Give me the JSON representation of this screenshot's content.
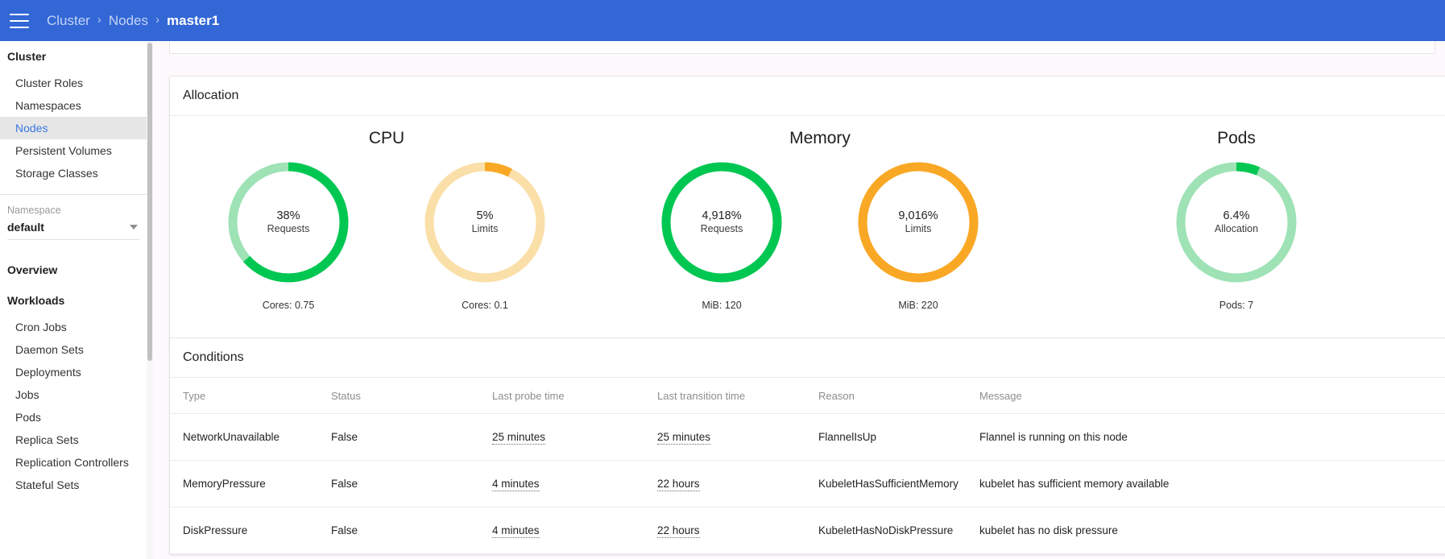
{
  "topbar": {
    "menu_icon": "hamburger-menu-icon",
    "breadcrumbs": [
      {
        "label": "Cluster",
        "current": false
      },
      {
        "label": "Nodes",
        "current": false
      },
      {
        "label": "master1",
        "current": true
      }
    ],
    "separator": "›",
    "background_color": "#3367d6"
  },
  "sidebar": {
    "cluster_title": "Cluster",
    "cluster_items": [
      {
        "label": "Cluster Roles",
        "active": false
      },
      {
        "label": "Namespaces",
        "active": false
      },
      {
        "label": "Nodes",
        "active": true
      },
      {
        "label": "Persistent Volumes",
        "active": false
      },
      {
        "label": "Storage Classes",
        "active": false
      }
    ],
    "namespace_label": "Namespace",
    "namespace_value": "default",
    "namespace_caret_icon": "chevron-down-icon",
    "overview_title": "Overview",
    "workloads_title": "Workloads",
    "workload_items": [
      {
        "label": "Cron Jobs"
      },
      {
        "label": "Daemon Sets"
      },
      {
        "label": "Deployments"
      },
      {
        "label": "Jobs"
      },
      {
        "label": "Pods"
      },
      {
        "label": "Replica Sets"
      },
      {
        "label": "Replication Controllers"
      },
      {
        "label": "Stateful Sets"
      }
    ],
    "active_color": "#3b78e7",
    "active_bg": "#e6e6e6"
  },
  "clipped_card": {
    "text": "…"
  },
  "allocation": {
    "title": "Allocation",
    "groups": [
      {
        "heading": "CPU",
        "donuts": [
          {
            "percent_label": "38%",
            "sub_label": "Requests",
            "footer_label": "Cores: 0.75",
            "fraction": 0.635,
            "arc_color": "#00c752",
            "track_color": "#9ee2b5"
          },
          {
            "percent_label": "5%",
            "sub_label": "Limits",
            "footer_label": "Cores: 0.1",
            "fraction": 0.075,
            "arc_color": "#f9a825",
            "track_color": "#fadfa8"
          }
        ]
      },
      {
        "heading": "Memory",
        "donuts": [
          {
            "percent_label": "4,918%",
            "sub_label": "Requests",
            "footer_label": "MiB: 120",
            "fraction": 1.0,
            "arc_color": "#00c752",
            "track_color": "#9ee2b5"
          },
          {
            "percent_label": "9,016%",
            "sub_label": "Limits",
            "footer_label": "MiB: 220",
            "fraction": 1.0,
            "arc_color": "#f9a825",
            "track_color": "#fadfa8"
          }
        ]
      },
      {
        "heading": "Pods",
        "donuts": [
          {
            "percent_label": "6.4%",
            "sub_label": "Allocation",
            "footer_label": "Pods: 7",
            "fraction": 0.064,
            "arc_color": "#00c752",
            "track_color": "#9ee2b5"
          }
        ]
      }
    ]
  },
  "conditions": {
    "title": "Conditions",
    "columns": [
      "Type",
      "Status",
      "Last probe time",
      "Last transition time",
      "Reason",
      "Message"
    ],
    "rows": [
      {
        "type": "NetworkUnavailable",
        "status": "False",
        "last_probe_time": "25 minutes",
        "last_transition_time": "25 minutes",
        "reason": "FlannelIsUp",
        "message": "Flannel is running on this node"
      },
      {
        "type": "MemoryPressure",
        "status": "False",
        "last_probe_time": "4 minutes",
        "last_transition_time": "22 hours",
        "reason": "KubeletHasSufficientMemory",
        "message": "kubelet has sufficient memory available"
      },
      {
        "type": "DiskPressure",
        "status": "False",
        "last_probe_time": "4 minutes",
        "last_transition_time": "22 hours",
        "reason": "KubeletHasNoDiskPressure",
        "message": "kubelet has no disk pressure"
      }
    ]
  }
}
